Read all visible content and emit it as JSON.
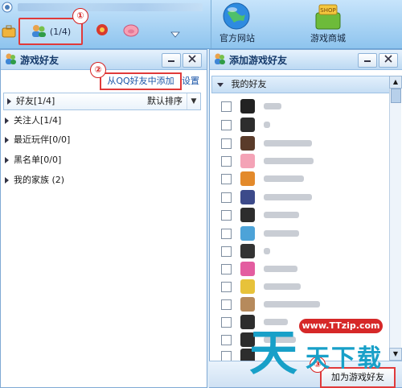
{
  "toolbar": {
    "friend_count": "(1/4)",
    "apps": [
      {
        "label": "官方网站"
      },
      {
        "label": "游戏商城"
      }
    ],
    "shop_tag": "SHOP"
  },
  "callouts": [
    "①",
    "②",
    "③"
  ],
  "left_panel": {
    "title": "游戏好友",
    "add_from_qq": "从QQ好友中添加",
    "settings": "设置",
    "sort_label": "默认排序",
    "groups": [
      {
        "label": "好友[1/4]"
      },
      {
        "label": "关注人[1/4]"
      },
      {
        "label": "最近玩伴[0/0]"
      },
      {
        "label": "黑名单[0/0]"
      },
      {
        "label": "我的家族 (2)"
      }
    ]
  },
  "right_panel": {
    "title": "添加游戏好友",
    "group_header": "我的好友",
    "add_button": "加为游戏好友"
  },
  "watermark": {
    "url": "www.TTzip.com",
    "glyph": "天",
    "text": "天下载"
  },
  "colors": {
    "highlight": "#e03a3a",
    "link": "#1b56a8",
    "panel_border": "#7fa9d4",
    "watermark": "#18a0c8"
  }
}
